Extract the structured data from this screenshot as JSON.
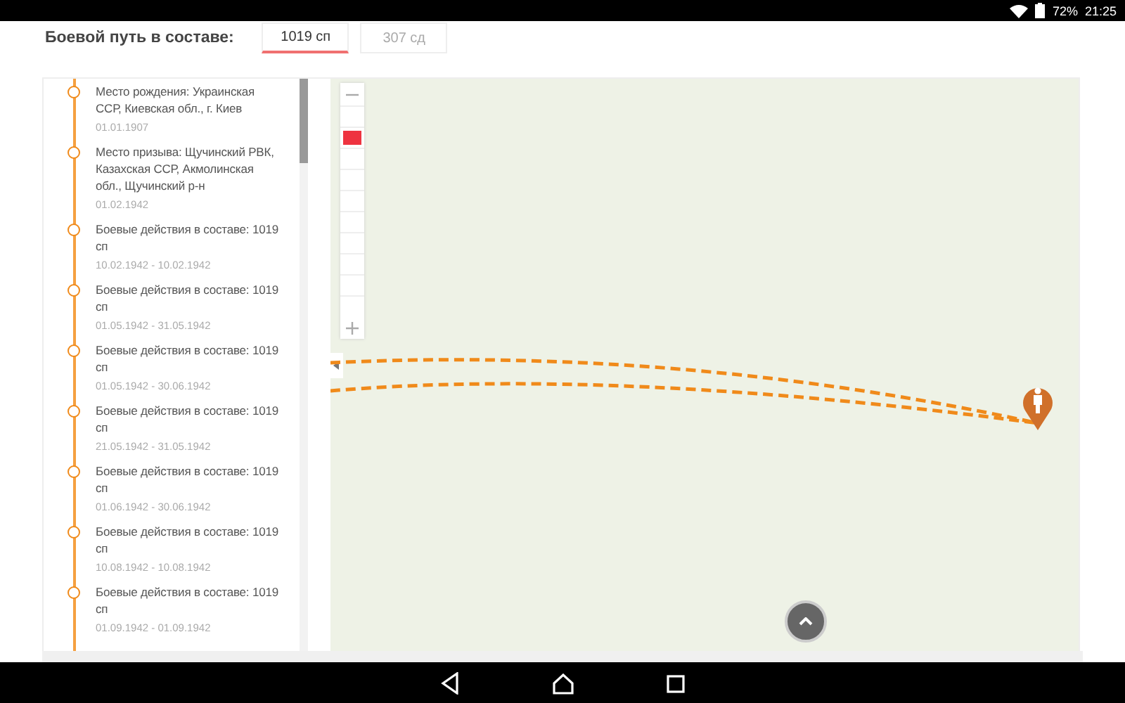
{
  "status_bar": {
    "battery": "72%",
    "time": "21:25"
  },
  "header": {
    "title": "Боевой путь в составе:",
    "tabs": [
      {
        "label": "1019 сп",
        "selected": true
      },
      {
        "label": "307 сд",
        "selected": false
      }
    ]
  },
  "timeline": [
    {
      "title": "Место рождения: Украинская ССР, Киевская обл., г. Киев",
      "dates": "01.01.1907"
    },
    {
      "title": "Место призыва: Щучинский РВК, Казахская ССР, Акмолинская обл., Щучинский р-н",
      "dates": "01.02.1942"
    },
    {
      "title": "Боевые действия в составе: 1019 сп",
      "dates": "10.02.1942 - 10.02.1942"
    },
    {
      "title": "Боевые действия в составе: 1019 сп",
      "dates": "01.05.1942 - 31.05.1942"
    },
    {
      "title": "Боевые действия в составе: 1019 сп",
      "dates": "01.05.1942 - 30.06.1942"
    },
    {
      "title": "Боевые действия в составе: 1019 сп",
      "dates": "21.05.1942 - 31.05.1942"
    },
    {
      "title": "Боевые действия в составе: 1019 сп",
      "dates": "01.06.1942 - 30.06.1942"
    },
    {
      "title": "Боевые действия в составе: 1019 сп",
      "dates": "10.08.1942 - 10.08.1942"
    },
    {
      "title": "Боевые действия в составе: 1019 сп",
      "dates": "01.09.1942 - 01.09.1942"
    }
  ],
  "map": {
    "zoom_steps": [
      {
        "selected": false
      },
      {
        "selected": true
      },
      {
        "selected": false
      },
      {
        "selected": false
      },
      {
        "selected": false
      },
      {
        "selected": false
      },
      {
        "selected": false
      },
      {
        "selected": false
      },
      {
        "selected": false
      },
      {
        "selected": false
      }
    ]
  }
}
